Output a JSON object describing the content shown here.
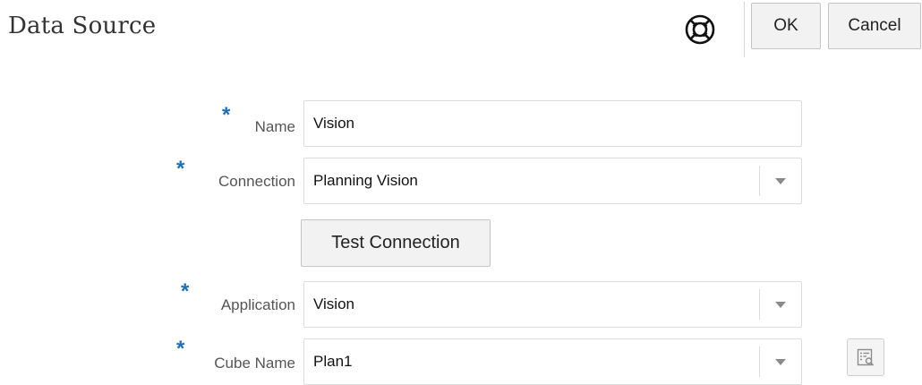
{
  "header": {
    "title": "Data Source",
    "help_icon": "lifebuoy-icon",
    "ok_label": "OK",
    "cancel_label": "Cancel"
  },
  "form": {
    "name": {
      "label": "Name",
      "value": "Vision",
      "required": true
    },
    "connection": {
      "label": "Connection",
      "value": "Planning Vision",
      "required": true
    },
    "test_button_label": "Test Connection",
    "application": {
      "label": "Application",
      "value": "Vision",
      "required": true
    },
    "cube_name": {
      "label": "Cube Name",
      "value": "Plan1",
      "required": true
    },
    "required_marker": "*",
    "member_selector_icon": "member-selector-icon"
  },
  "colors": {
    "required_marker": "#1d6fb8",
    "button_bg": "#f2f2f2",
    "border": "#dcdcdc"
  }
}
